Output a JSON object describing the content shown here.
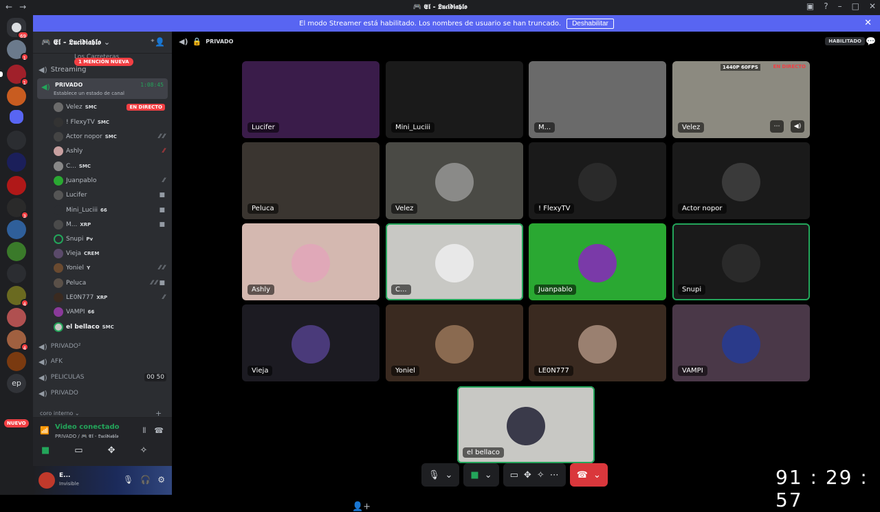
{
  "window": {
    "title": "🎮 𝕰𝖑 - 𝕷𝖚𝖈𝖎𝖉𝖎𝖆𝖇𝖑𝖔",
    "back": "←",
    "forward": "→"
  },
  "banner": {
    "message": "El modo Streamer está habilitado. Los nombres de usuario se han truncado.",
    "button": "Deshabilitar"
  },
  "guilds": {
    "home_badge": "69",
    "nuevo": "NUEVO",
    "ep": "ep",
    "badges": [
      "1",
      "1",
      "3",
      "4",
      "4"
    ]
  },
  "server": {
    "name": "🎮 𝕰𝖑 - 𝕷𝖚𝖈𝖎𝖉𝖎𝖆𝖇𝖑𝖔",
    "channels_top": [
      "Los Carreteras",
      "Streaming"
    ],
    "mention_badge": "1 MENCIÓN NUEVA",
    "active_channel": {
      "name": "PRIVADO",
      "timer": "1:08:45",
      "status": "Establece un estado de canal"
    },
    "members": [
      {
        "name": "Velez",
        "tag": "SMC",
        "live": "EN DIRECTO"
      },
      {
        "name": "! FlexyTV",
        "tag": "SMC"
      },
      {
        "name": "Actor nopor",
        "tag": "SMC"
      },
      {
        "name": "Ashly",
        "tag": ""
      },
      {
        "name": "C...",
        "tag": "SMC"
      },
      {
        "name": "Juanpablo",
        "tag": ""
      },
      {
        "name": "Lucifer",
        "tag": ""
      },
      {
        "name": "Mini_Luciii",
        "tag": "66"
      },
      {
        "name": "M...",
        "tag": "XRP"
      },
      {
        "name": "Snupi",
        "tag": "Pv"
      },
      {
        "name": "Vieja",
        "tag": "CREM"
      },
      {
        "name": "Yoniel",
        "tag": "Y"
      },
      {
        "name": "Peluca",
        "tag": ""
      },
      {
        "name": "LE0N777",
        "tag": "XRP"
      },
      {
        "name": "VAMPI",
        "tag": "66"
      },
      {
        "name": "el bellaco",
        "tag": "SMC"
      }
    ],
    "channels_bottom": [
      {
        "name": "PRIVADO²",
        "extra": ""
      },
      {
        "name": "AFK",
        "extra": ""
      },
      {
        "name": "PELICULAS",
        "extra": "00 50"
      },
      {
        "name": "PRIVADO",
        "extra": ""
      }
    ],
    "category": "coro interno"
  },
  "voice": {
    "connected": "Video conectado",
    "location": "PRIVADO / 🎮 𝕰𝖑 - 𝕷𝖚𝖈𝖎𝖉𝖎𝖆𝖇𝖑𝖔"
  },
  "user": {
    "name": "E...",
    "status": "Invisible"
  },
  "stage": {
    "channel": "PRIVADO",
    "habilitado": "HABILITADO",
    "tiles": [
      {
        "label": "Lucifer",
        "bg": "#3a1c4a"
      },
      {
        "label": "Mini_Luciii",
        "bg": "#1a1a1a"
      },
      {
        "label": "M...",
        "bg": "#6a6a6a"
      },
      {
        "label": "Velez",
        "bg": "#8c8a80",
        "quality": "1440P 60FPS",
        "live": "EN DIRECTO"
      },
      {
        "label": "Peluca",
        "bg": "#3a3530"
      },
      {
        "label": "Velez",
        "bg": "#4a4a45"
      },
      {
        "label": "! FlexyTV",
        "bg": "#1a1a1a"
      },
      {
        "label": "Actor nopor",
        "bg": "#1a1a1a"
      },
      {
        "label": "Ashly",
        "bg": "#d4b8b0"
      },
      {
        "label": "C...",
        "bg": "#c8c8c4"
      },
      {
        "label": "Juanpablo",
        "bg": "#2aa832"
      },
      {
        "label": "Snupi",
        "bg": "#1a1a1a"
      },
      {
        "label": "Vieja",
        "bg": "#1c1b22"
      },
      {
        "label": "Yoniel",
        "bg": "#3a2a20"
      },
      {
        "label": "LE0N777",
        "bg": "#3a2a20"
      },
      {
        "label": "VAMPI",
        "bg": "#4a3848"
      },
      {
        "label": "el bellaco",
        "bg": "#c8c8c4"
      }
    ]
  },
  "clock": "91 : 29 : 57"
}
